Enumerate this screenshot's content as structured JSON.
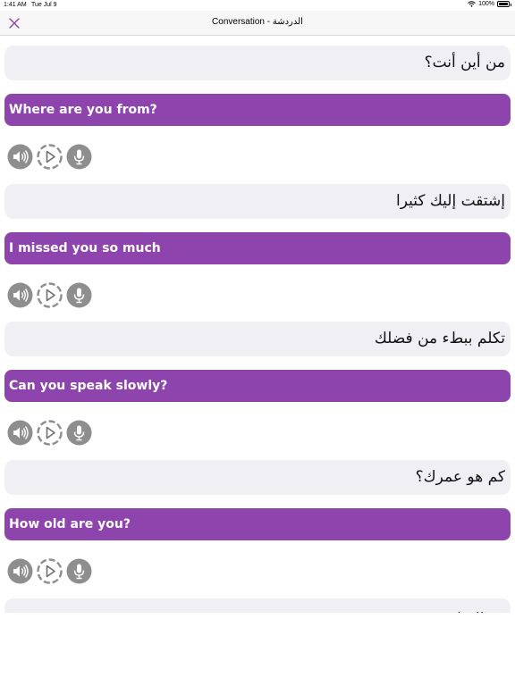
{
  "status_bar": {
    "time": "1:41 AM",
    "date": "Tue Jul 9",
    "battery": "100%",
    "battery_level": 1.0
  },
  "nav": {
    "title": "Conversation - الدردشة",
    "close_icon": "close-x-icon",
    "accent_color": "#8e44ad"
  },
  "phrases": [
    {
      "arabic": "من أين أنت؟",
      "english": "Where are you from?"
    },
    {
      "arabic": "إشتقت إليك كثيرا",
      "english": "I missed you so much"
    },
    {
      "arabic": "تكلم ببطء من فضلك",
      "english": "Can you speak slowly?"
    },
    {
      "arabic": "كم هو عمرك؟",
      "english": "How old are you?"
    },
    {
      "arabic": "مع السلامة",
      "english": ""
    }
  ],
  "controls": {
    "icons": [
      "speaker-icon",
      "play-icon",
      "microphone-icon"
    ]
  }
}
